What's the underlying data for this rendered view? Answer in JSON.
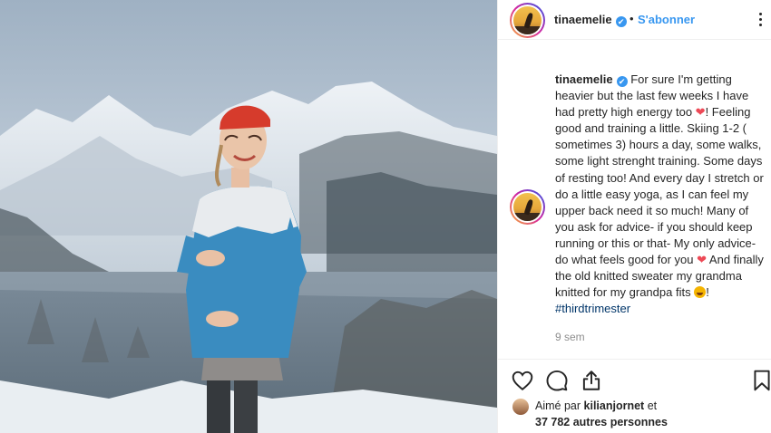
{
  "post": {
    "username": "tinaemelie",
    "verified_mark": "✔",
    "separator": "•",
    "follow_label": "S'abonner",
    "caption_username": "tinaemelie",
    "caption_1": "For sure I'm getting heavier but the last few weeks I have had pretty high energy too ",
    "caption_2": "! Feeling good and training a little. Skiing 1-2 ( sometimes 3) hours a day, some walks, some light strenght training. Some days of resting too! And every day I stretch or do a little easy yoga, as I can feel my upper back need it so much! Many of you ask for advice- if you should keep running or this or that- My only advice- do what feels good for you ",
    "caption_3": "And finally the old knitted sweater my grandma knitted for my grandpa fits ",
    "caption_4": "!",
    "hashtag": "#thirdtrimester",
    "heart_emoji": "❤",
    "time_ago": "9 sem"
  },
  "likes": {
    "prefix": "Aimé par",
    "liker": "kilianjornet",
    "conj": "et",
    "others": "37 782 autres personnes"
  },
  "icons": {
    "more": "more-options-icon",
    "like": "heart-icon",
    "comment": "comment-icon",
    "share": "share-icon",
    "save": "bookmark-icon"
  },
  "colors": {
    "link": "#3897f0",
    "hashtag": "#003569",
    "heart": "#ed4956",
    "muted": "#8e8e8e",
    "sweater_blue": "#3a8cc0"
  }
}
